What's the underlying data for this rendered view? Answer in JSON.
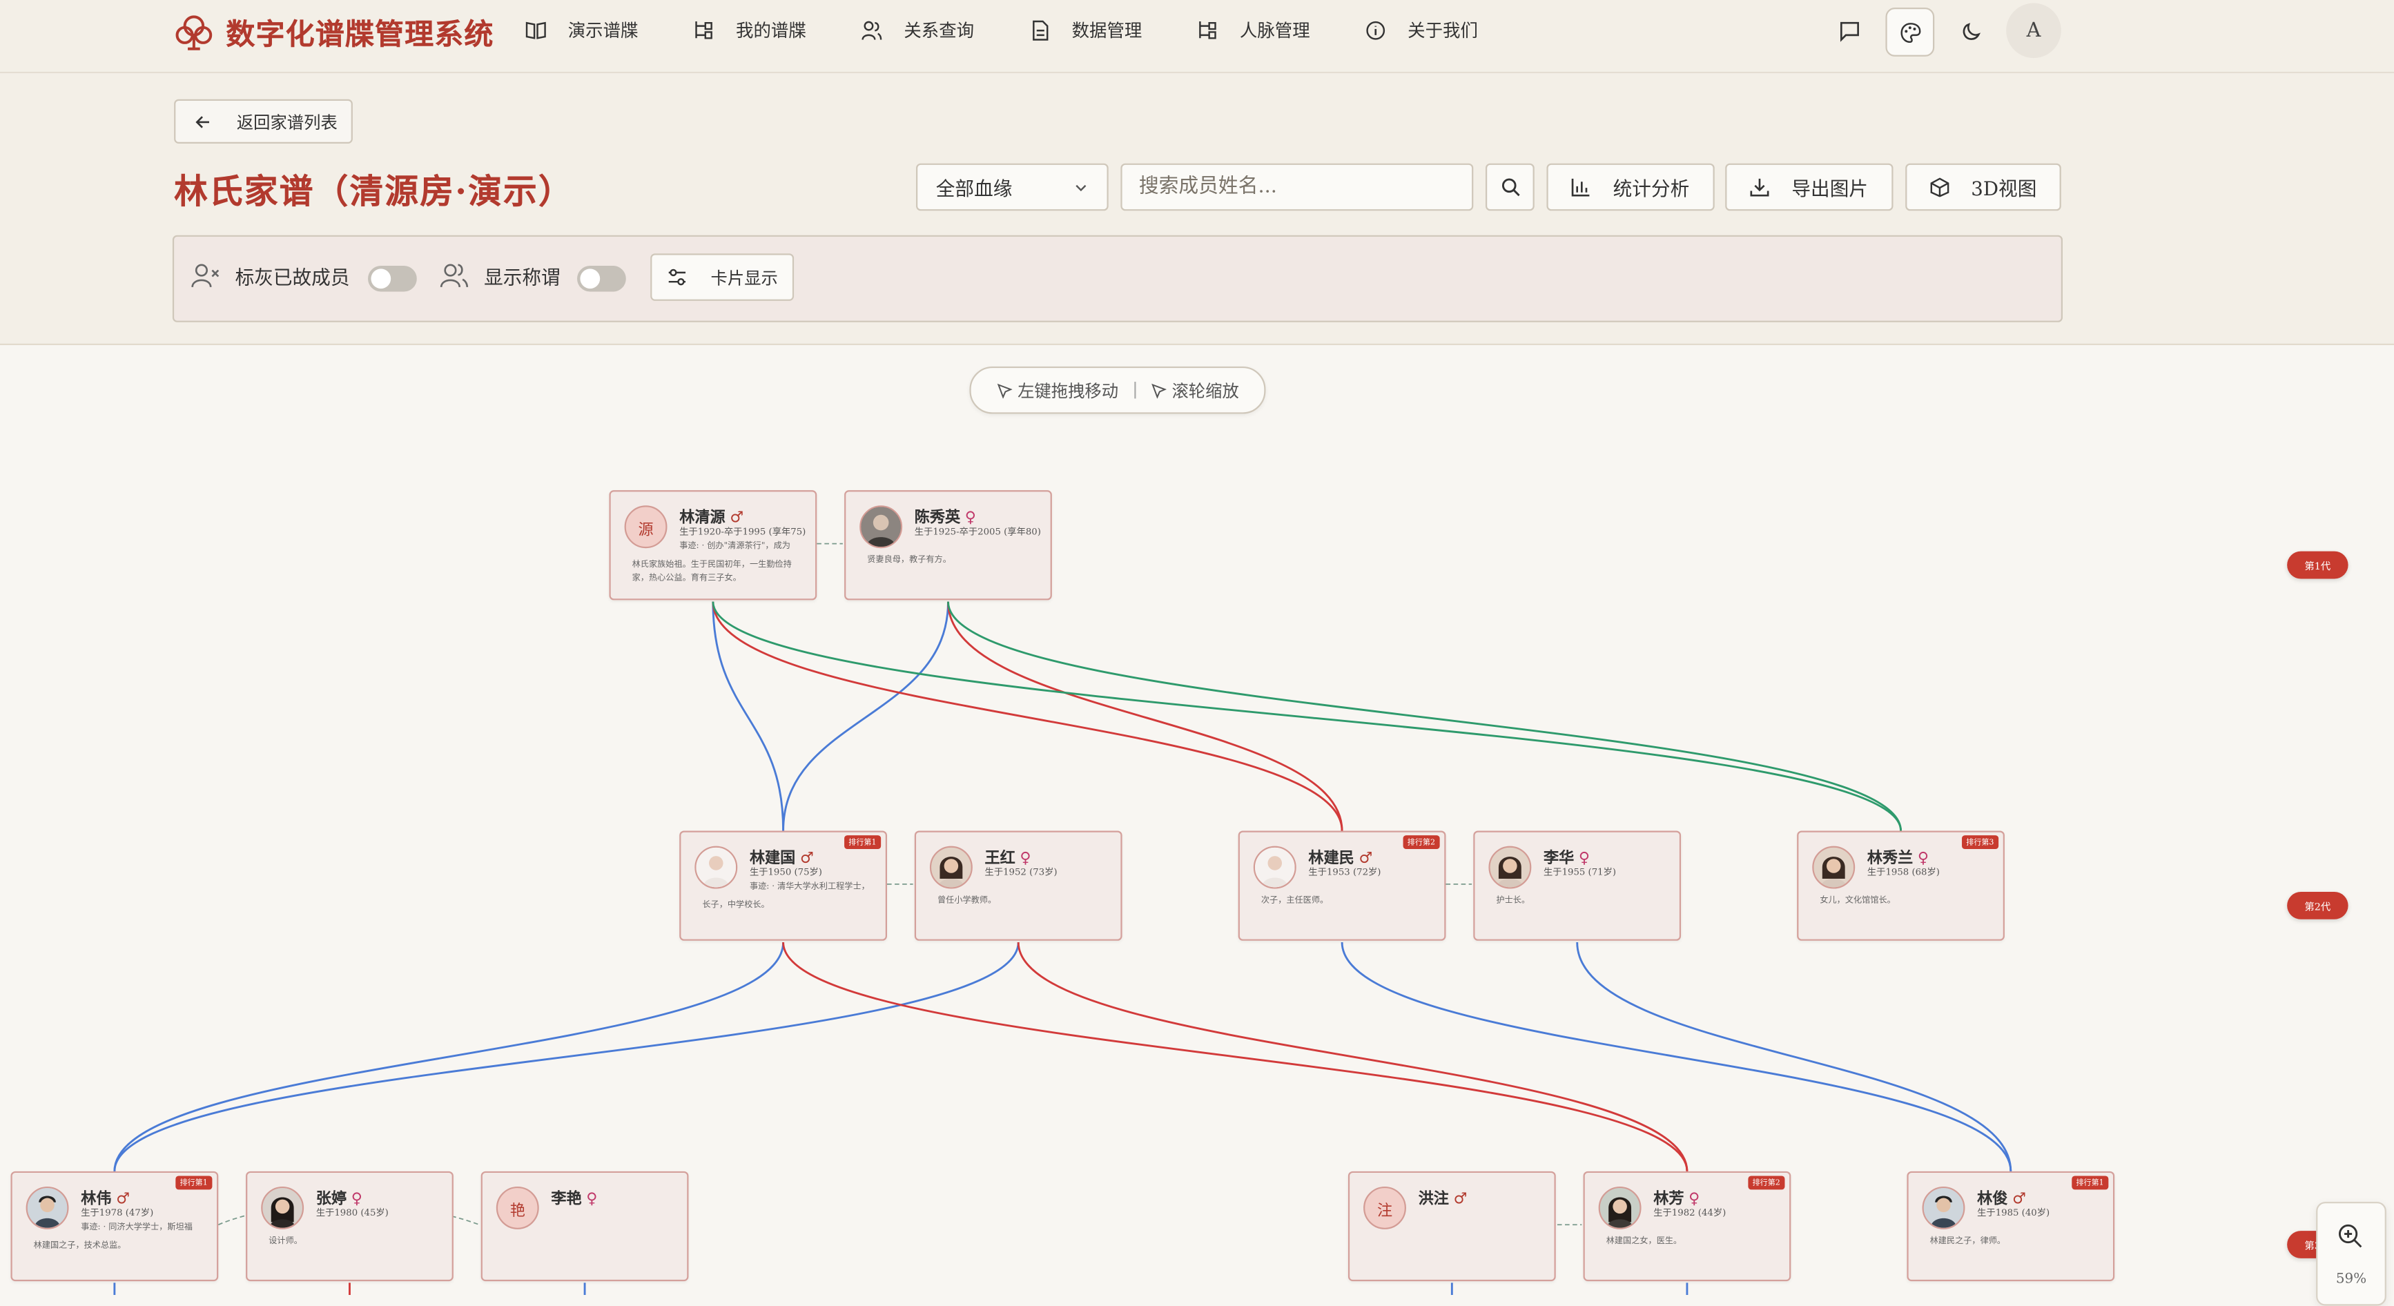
{
  "app": {
    "title": "数字化谱牒管理系统",
    "avatar_letter": "A"
  },
  "nav": [
    {
      "label": "演示谱牒",
      "icon": "book-icon"
    },
    {
      "label": "我的谱牒",
      "icon": "tree-icon"
    },
    {
      "label": "关系查询",
      "icon": "users-icon"
    },
    {
      "label": "数据管理",
      "icon": "file-icon"
    },
    {
      "label": "人脉管理",
      "icon": "network-icon"
    },
    {
      "label": "关于我们",
      "icon": "info-icon"
    }
  ],
  "controls": {
    "back_label": "返回家谱列表",
    "title": "林氏家谱（清源房·演示）",
    "lineage_select": "全部血缘",
    "search_placeholder": "搜索成员姓名...",
    "stats_label": "统计分析",
    "export_label": "导出图片",
    "view3d_label": "3D视图",
    "gray_deceased_label": "标灰已故成员",
    "show_titles_label": "显示称谓",
    "card_display_label": "卡片显示",
    "gray_deceased_on": false,
    "show_titles_on": false
  },
  "hint": {
    "drag": "左键拖拽移动",
    "wheel": "滚轮缩放"
  },
  "zoom": {
    "level": "59%"
  },
  "generations": [
    "第1代",
    "第2代",
    "第3代"
  ],
  "members": {
    "m1": {
      "name": "林清源",
      "gender": "♂",
      "avatar": "源",
      "dates": "生于1920-卒于1995 (享年75)",
      "event": "事迹: · 创办\"清源茶行\"，成为",
      "bio": "林氏家族始祖。生于民国初年，一生勤俭持家，热心公益。育有三子女。"
    },
    "m2": {
      "name": "陈秀英",
      "gender": "♀",
      "dates": "生于1925-卒于2005 (享年80)",
      "bio": "贤妻良母，教子有方。"
    },
    "m3": {
      "name": "林建国",
      "gender": "♂",
      "rank": "排行第1",
      "dates": "生于1950 (75岁)",
      "event": "事迹: · 清华大学水利工程学士，",
      "bio": "长子，中学校长。"
    },
    "m4": {
      "name": "王红",
      "gender": "♀",
      "dates": "生于1952 (73岁)",
      "bio": "曾任小学教师。"
    },
    "m5": {
      "name": "林建民",
      "gender": "♂",
      "rank": "排行第2",
      "dates": "生于1953 (72岁)",
      "bio": "次子，主任医师。"
    },
    "m6": {
      "name": "李华",
      "gender": "♀",
      "dates": "生于1955 (71岁)",
      "bio": "护士长。"
    },
    "m7": {
      "name": "林秀兰",
      "gender": "♀",
      "rank": "排行第3",
      "dates": "生于1958 (68岁)",
      "bio": "女儿，文化馆馆长。"
    },
    "m8": {
      "name": "林伟",
      "gender": "♂",
      "rank": "排行第1",
      "dates": "生于1978 (47岁)",
      "event": "事迹: · 同济大学学士，斯坦福",
      "bio": "林建国之子，技术总监。"
    },
    "m9": {
      "name": "张婷",
      "gender": "♀",
      "dates": "生于1980 (45岁)",
      "bio": "设计师。"
    },
    "m10": {
      "name": "李艳",
      "gender": "♀",
      "avatar": "艳"
    },
    "m11": {
      "name": "洪注",
      "gender": "♂",
      "avatar": "注"
    },
    "m12": {
      "name": "林芳",
      "gender": "♀",
      "rank": "排行第2",
      "dates": "生于1982 (44岁)",
      "bio": "林建国之女，医生。"
    },
    "m13": {
      "name": "林俊",
      "gender": "♂",
      "rank": "排行第1",
      "dates": "生于1985 (40岁)",
      "bio": "林建民之子，律师。"
    }
  },
  "colors": {
    "accent": "#b23a2e",
    "blood_line": "#4a7bd6",
    "line_red": "#d23a3a",
    "line_green": "#2e9a6c",
    "badge": "#c83b2f"
  }
}
